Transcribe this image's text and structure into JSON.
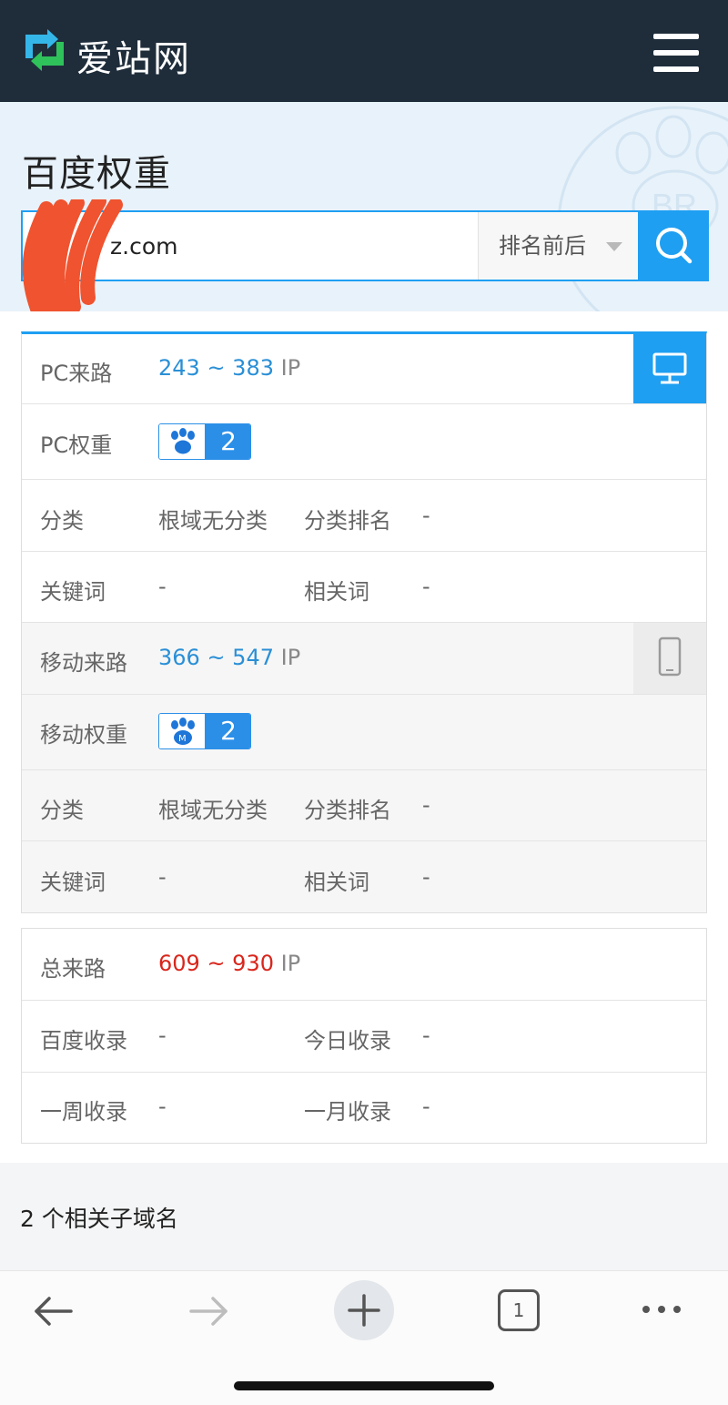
{
  "header": {
    "brand": "爱站网",
    "logo_icon": "aizhan-logo-icon",
    "menu_icon": "hamburger-menu-icon"
  },
  "search": {
    "title": "百度权重",
    "query_visible": "z.com",
    "sort_label": "排名前后",
    "search_icon": "search-icon"
  },
  "pc": {
    "traffic_label": "PC来路",
    "traffic_value": "243 ~ 383",
    "traffic_unit": "IP",
    "weight_label": "PC权重",
    "weight_value": "2",
    "category_label": "分类",
    "category_value": "根域无分类",
    "category_rank_label": "分类排名",
    "category_rank_value": "-",
    "keyword_label": "关键词",
    "keyword_value": "-",
    "related_label": "相关词",
    "related_value": "-",
    "device_icon": "desktop-monitor-icon"
  },
  "mobile": {
    "traffic_label": "移动来路",
    "traffic_value": "366 ~ 547",
    "traffic_unit": "IP",
    "weight_label": "移动权重",
    "weight_value": "2",
    "category_label": "分类",
    "category_value": "根域无分类",
    "category_rank_label": "分类排名",
    "category_rank_value": "-",
    "keyword_label": "关键词",
    "keyword_value": "-",
    "related_label": "相关词",
    "related_value": "-",
    "device_icon": "mobile-phone-icon"
  },
  "totals": {
    "traffic_label": "总来路",
    "traffic_value": "609 ~ 930",
    "traffic_unit": "IP",
    "baidu_index_label": "百度收录",
    "baidu_index_value": "-",
    "today_index_label": "今日收录",
    "today_index_value": "-",
    "week_index_label": "一周收录",
    "week_index_value": "-",
    "month_index_label": "一月收录",
    "month_index_value": "-"
  },
  "subdomains": {
    "title": "2 个相关子域名"
  },
  "browser": {
    "tab_count": "1",
    "icons": [
      "back-arrow-icon",
      "forward-arrow-icon",
      "new-tab-plus-icon",
      "tabs-icon",
      "more-icon"
    ]
  },
  "colors": {
    "header_bg": "#1f2d3b",
    "accent_blue": "#1e9ff2",
    "badge_blue": "#2b8fe8",
    "traffic_blue": "#2a8fd6",
    "total_red": "#d9261c"
  }
}
